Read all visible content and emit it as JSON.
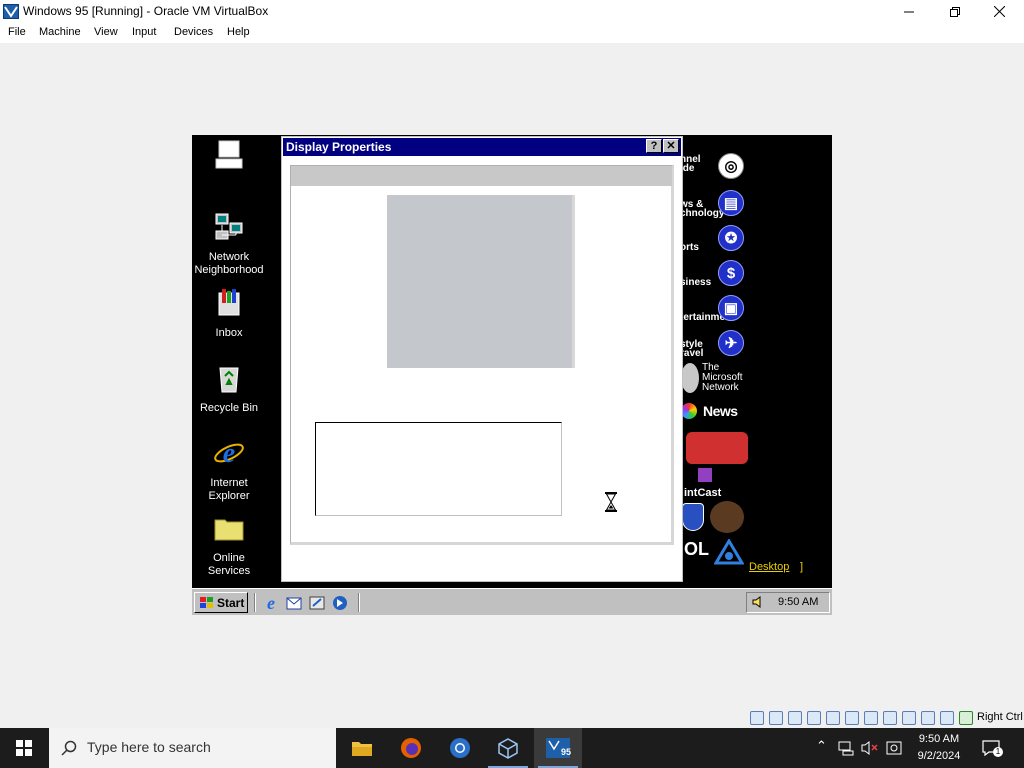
{
  "window": {
    "title": "Windows 95 [Running] - Oracle VM VirtualBox",
    "icon": "virtualbox-icon",
    "controls": [
      "minimize",
      "maximize",
      "close"
    ]
  },
  "menu": [
    "File",
    "Machine",
    "View",
    "Input",
    "Devices",
    "Help"
  ],
  "guest": {
    "desktop_icons": [
      {
        "label": "",
        "icon": "my-computer-icon"
      },
      {
        "label": "Network Neighborhood",
        "line1": "Network",
        "line2": "Neighborhood",
        "icon": "network-neighborhood-icon"
      },
      {
        "label": "Inbox",
        "icon": "inbox-icon"
      },
      {
        "label": "Recycle Bin",
        "icon": "recycle-bin-icon"
      },
      {
        "label": "Internet Explorer",
        "line1": "Internet",
        "line2": "Explorer",
        "icon": "internet-explorer-icon"
      },
      {
        "label": "Online Services",
        "line1": "Online",
        "line2": "Services",
        "icon": "online-services-folder-icon"
      }
    ],
    "channel_bar": {
      "channel_guide": [
        "nnel",
        "ide"
      ],
      "news_tech": [
        "ws &",
        "chnology"
      ],
      "sports": "orts",
      "business": "siness",
      "entertainment": "tertainment",
      "lifestyle": [
        "style",
        "ravel"
      ],
      "msn": [
        "The",
        "Microsoft",
        "Network"
      ],
      "msnbc": "News",
      "pointcast": "intCast",
      "aol": "OL",
      "desktop_link": "Desktop",
      "desktop_bracket": "]"
    },
    "dialog": {
      "title": "Display Properties",
      "help_label": "?",
      "close_label": "✕"
    },
    "taskbar": {
      "start_label": "Start",
      "clock": "9:50 AM"
    }
  },
  "host_status": {
    "right_ctrl": "Right Ctrl"
  },
  "win10": {
    "search_placeholder": "Type here to search",
    "time": "9:50 AM",
    "date": "9/2/2024",
    "notification_count": "1",
    "pinned": [
      "file-explorer",
      "firefox",
      "chrome",
      "virtualbox-manager",
      "windows-95-vm"
    ]
  }
}
